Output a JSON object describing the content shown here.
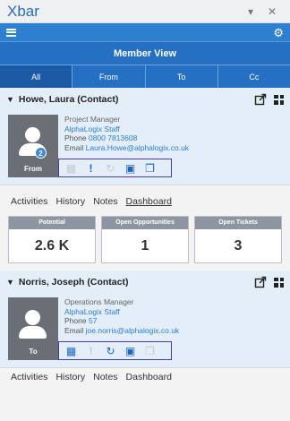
{
  "window": {
    "title": "Xbar",
    "min_glyph": "▾",
    "close_glyph": "✕"
  },
  "appbar": {
    "menu_icon": "hamburger-icon",
    "settings_icon": "gear-icon",
    "accent": "#2d7fd0"
  },
  "view": {
    "title": "Member View"
  },
  "tabs": [
    {
      "label": "All",
      "active": true
    },
    {
      "label": "From"
    },
    {
      "label": "To"
    },
    {
      "label": "Cc"
    }
  ],
  "contacts": [
    {
      "name": "Howe, Laura (Contact)",
      "role": "From",
      "badge": "2",
      "job": "Project Manager",
      "org": "AlphaLogix Staff",
      "phone_label": "Phone",
      "phone": "0800 7813608",
      "email_label": "Email",
      "email": "Laura.Howe@alphalogix.co.uk",
      "actions": [
        {
          "icon": "calendar-icon",
          "glyph": "▦",
          "enabled": false
        },
        {
          "icon": "priority-icon",
          "glyph": "!",
          "enabled": true
        },
        {
          "icon": "history-icon",
          "glyph": "↻",
          "enabled": false
        },
        {
          "icon": "money-icon",
          "glyph": "▣",
          "enabled": true
        },
        {
          "icon": "copy-icon",
          "glyph": "❐",
          "enabled": true
        }
      ]
    },
    {
      "name": "Norris, Joseph (Contact)",
      "role": "To",
      "job": "Operations Manager",
      "org": "AlphaLogix Staff",
      "phone_label": "Phone",
      "phone": "57",
      "email_label": "Email",
      "email": "joe.norris@alphalogix.co.uk",
      "actions": [
        {
          "icon": "calendar-icon",
          "glyph": "▦",
          "enabled": true
        },
        {
          "icon": "priority-icon",
          "glyph": "!",
          "enabled": false
        },
        {
          "icon": "history-icon",
          "glyph": "↻",
          "enabled": true
        },
        {
          "icon": "money-icon",
          "glyph": "▣",
          "enabled": true
        },
        {
          "icon": "copy-icon",
          "glyph": "❐",
          "enabled": false
        }
      ]
    }
  ],
  "subtabs": [
    "Activities",
    "History",
    "Notes",
    "Dashboard"
  ],
  "active_subtab": "Dashboard",
  "kpis": [
    {
      "label": "Potential",
      "value": "2.6 K"
    },
    {
      "label": "Open Opportunities",
      "value": "1"
    },
    {
      "label": "Open Tickets",
      "value": "3"
    }
  ]
}
